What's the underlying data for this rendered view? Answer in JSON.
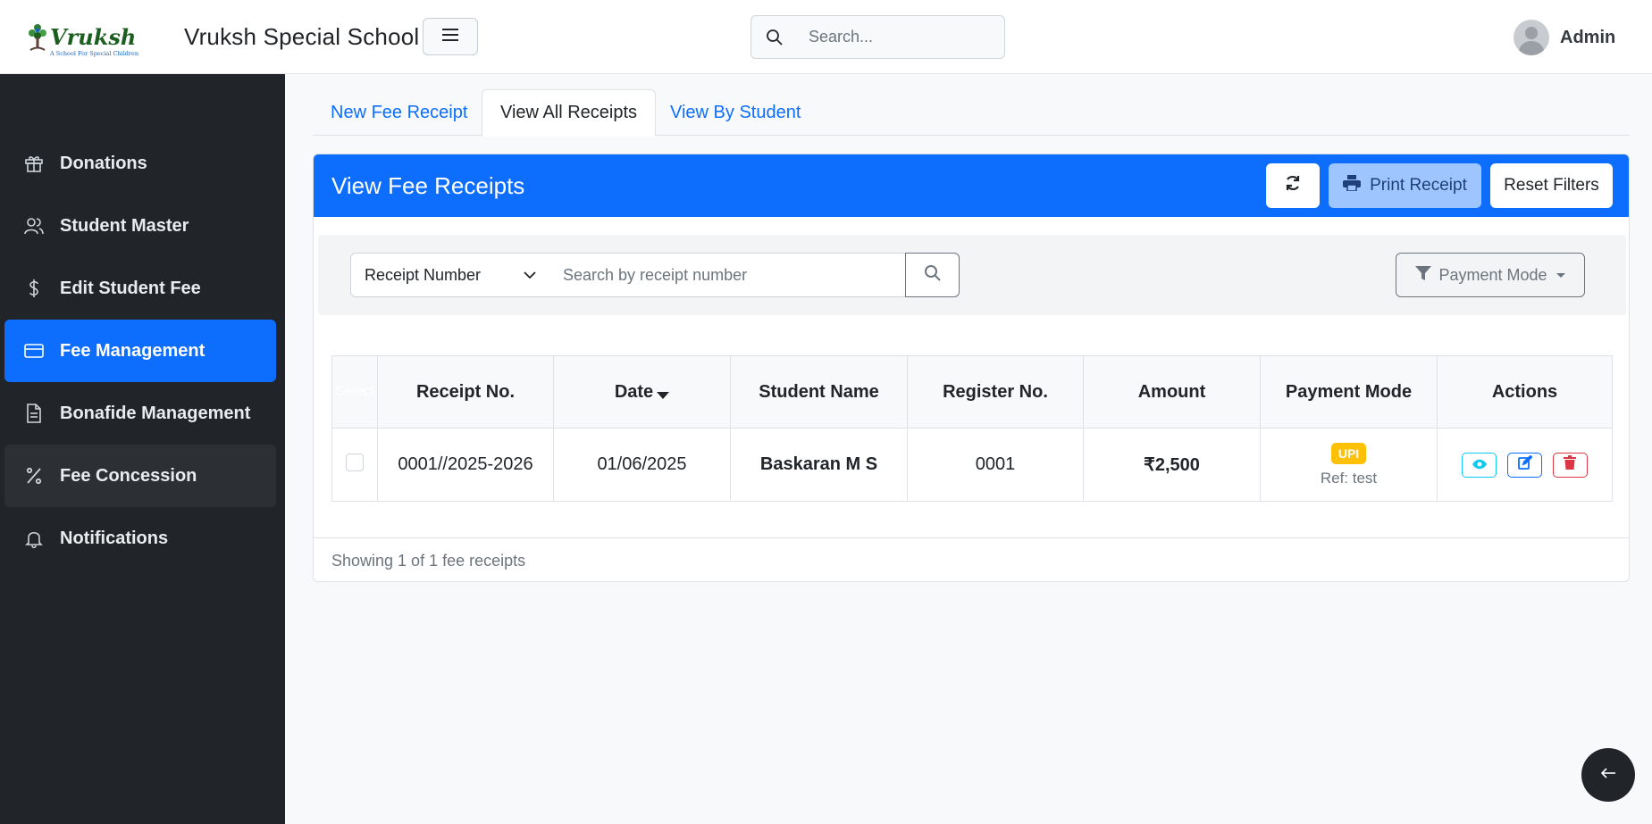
{
  "brand": {
    "name": "Vruksh Special School",
    "logo_text": "Vruksh",
    "logo_tagline": "A School For Special Children"
  },
  "header": {
    "search_placeholder": "Search...",
    "user_name": "Admin"
  },
  "sidebar": {
    "items": [
      {
        "label": "Donations",
        "icon": "gift-icon"
      },
      {
        "label": "Student Master",
        "icon": "users-icon"
      },
      {
        "label": "Edit Student Fee",
        "icon": "dollar-icon"
      },
      {
        "label": "Fee Management",
        "icon": "credit-card-icon",
        "active": true
      },
      {
        "label": "Bonafide Management",
        "icon": "document-icon"
      },
      {
        "label": "Fee Concession",
        "icon": "percent-icon"
      },
      {
        "label": "Notifications",
        "icon": "bell-icon"
      }
    ]
  },
  "tabs": [
    {
      "label": "New Fee Receipt"
    },
    {
      "label": "View All Receipts",
      "active": true
    },
    {
      "label": "View By Student"
    }
  ],
  "card": {
    "title": "View Fee Receipts",
    "print_label": "Print Receipt",
    "reset_label": "Reset Filters"
  },
  "filters": {
    "search_by": "Receipt Number",
    "search_placeholder": "Search by receipt number",
    "payment_mode_label": "Payment Mode"
  },
  "table": {
    "columns": [
      "Select",
      "Receipt No.",
      "Date",
      "Student Name",
      "Register No.",
      "Amount",
      "Payment Mode",
      "Actions"
    ],
    "rows": [
      {
        "receipt_no": "0001//2025-2026",
        "date": "01/06/2025",
        "student_name": "Baskaran M S",
        "register_no": "0001",
        "amount": "₹2,500",
        "payment_mode": "UPI",
        "ref": "Ref: test"
      }
    ]
  },
  "footer": {
    "summary": "Showing 1 of 1 fee receipts"
  },
  "colors": {
    "primary": "#0d6efd",
    "sidebar_bg": "#212529",
    "badge_upi": "#ffc107",
    "danger": "#dc3545",
    "info": "#0dcaf0"
  }
}
